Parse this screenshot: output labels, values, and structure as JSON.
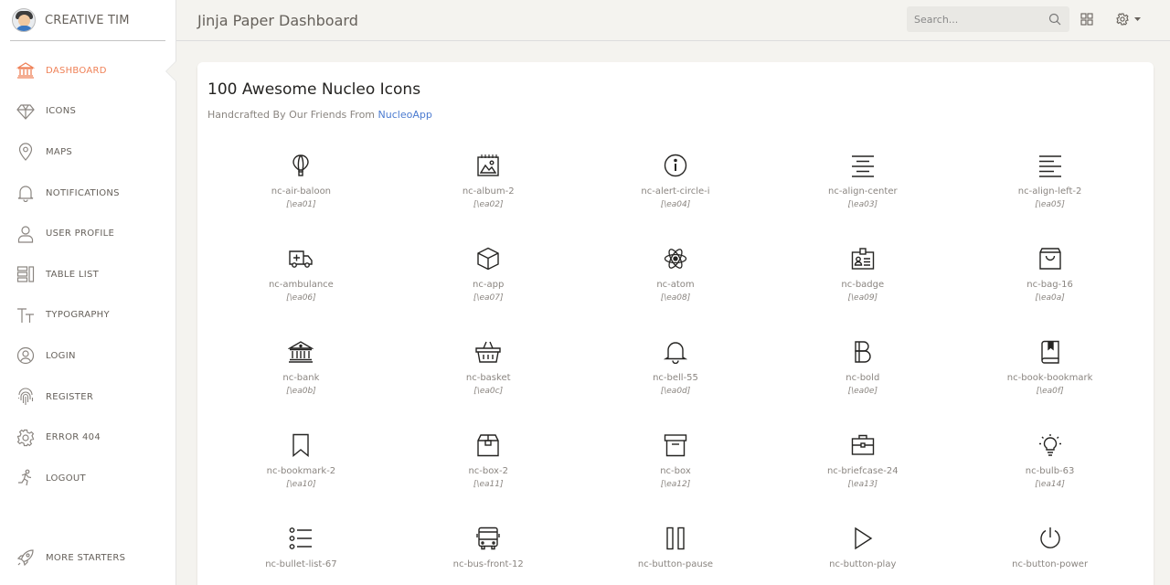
{
  "brand": {
    "name": "CREATIVE TIM"
  },
  "sidebar": {
    "items": [
      {
        "label": "DASHBOARD",
        "icon": "bank-icon",
        "active": true
      },
      {
        "label": "ICONS",
        "icon": "diamond-icon"
      },
      {
        "label": "MAPS",
        "icon": "pin-icon"
      },
      {
        "label": "NOTIFICATIONS",
        "icon": "bell-icon"
      },
      {
        "label": "USER PROFILE",
        "icon": "user-icon"
      },
      {
        "label": "TABLE LIST",
        "icon": "tile-icon"
      },
      {
        "label": "TYPOGRAPHY",
        "icon": "caps-icon"
      },
      {
        "label": "LOGIN",
        "icon": "user-circle-icon"
      },
      {
        "label": "REGISTER",
        "icon": "fingerprint-icon"
      },
      {
        "label": "ERROR 404",
        "icon": "gear-icon"
      },
      {
        "label": "LOGOUT",
        "icon": "runner-icon"
      }
    ],
    "more": {
      "label": "MORE STARTERS",
      "icon": "rocket-icon"
    }
  },
  "topbar": {
    "title": "Jinja Paper Dashboard",
    "search_placeholder": "Search..."
  },
  "card": {
    "title": "100 Awesome Nucleo Icons",
    "subtitle": "Handcrafted By Our Friends From",
    "subtitle_link": "NucleoApp"
  },
  "icons": [
    {
      "name": "nc-air-baloon",
      "code": "[\\ea01]"
    },
    {
      "name": "nc-album-2",
      "code": "[\\ea02]"
    },
    {
      "name": "nc-alert-circle-i",
      "code": "[\\ea04]"
    },
    {
      "name": "nc-align-center",
      "code": "[\\ea03]"
    },
    {
      "name": "nc-align-left-2",
      "code": "[\\ea05]"
    },
    {
      "name": "nc-ambulance",
      "code": "[\\ea06]"
    },
    {
      "name": "nc-app",
      "code": "[\\ea07]"
    },
    {
      "name": "nc-atom",
      "code": "[\\ea08]"
    },
    {
      "name": "nc-badge",
      "code": "[\\ea09]"
    },
    {
      "name": "nc-bag-16",
      "code": "[\\ea0a]"
    },
    {
      "name": "nc-bank",
      "code": "[\\ea0b]"
    },
    {
      "name": "nc-basket",
      "code": "[\\ea0c]"
    },
    {
      "name": "nc-bell-55",
      "code": "[\\ea0d]"
    },
    {
      "name": "nc-bold",
      "code": "[\\ea0e]"
    },
    {
      "name": "nc-book-bookmark",
      "code": "[\\ea0f]"
    },
    {
      "name": "nc-bookmark-2",
      "code": "[\\ea10]"
    },
    {
      "name": "nc-box-2",
      "code": "[\\ea11]"
    },
    {
      "name": "nc-box",
      "code": "[\\ea12]"
    },
    {
      "name": "nc-briefcase-24",
      "code": "[\\ea13]"
    },
    {
      "name": "nc-bulb-63",
      "code": "[\\ea14]"
    },
    {
      "name": "nc-bullet-list-67",
      "code": ""
    },
    {
      "name": "nc-bus-front-12",
      "code": ""
    },
    {
      "name": "nc-button-pause",
      "code": ""
    },
    {
      "name": "nc-button-play",
      "code": ""
    },
    {
      "name": "nc-button-power",
      "code": ""
    }
  ],
  "colors": {
    "accent": "#ef8157",
    "link": "#4b7bd0",
    "text_muted": "#8a8580"
  }
}
